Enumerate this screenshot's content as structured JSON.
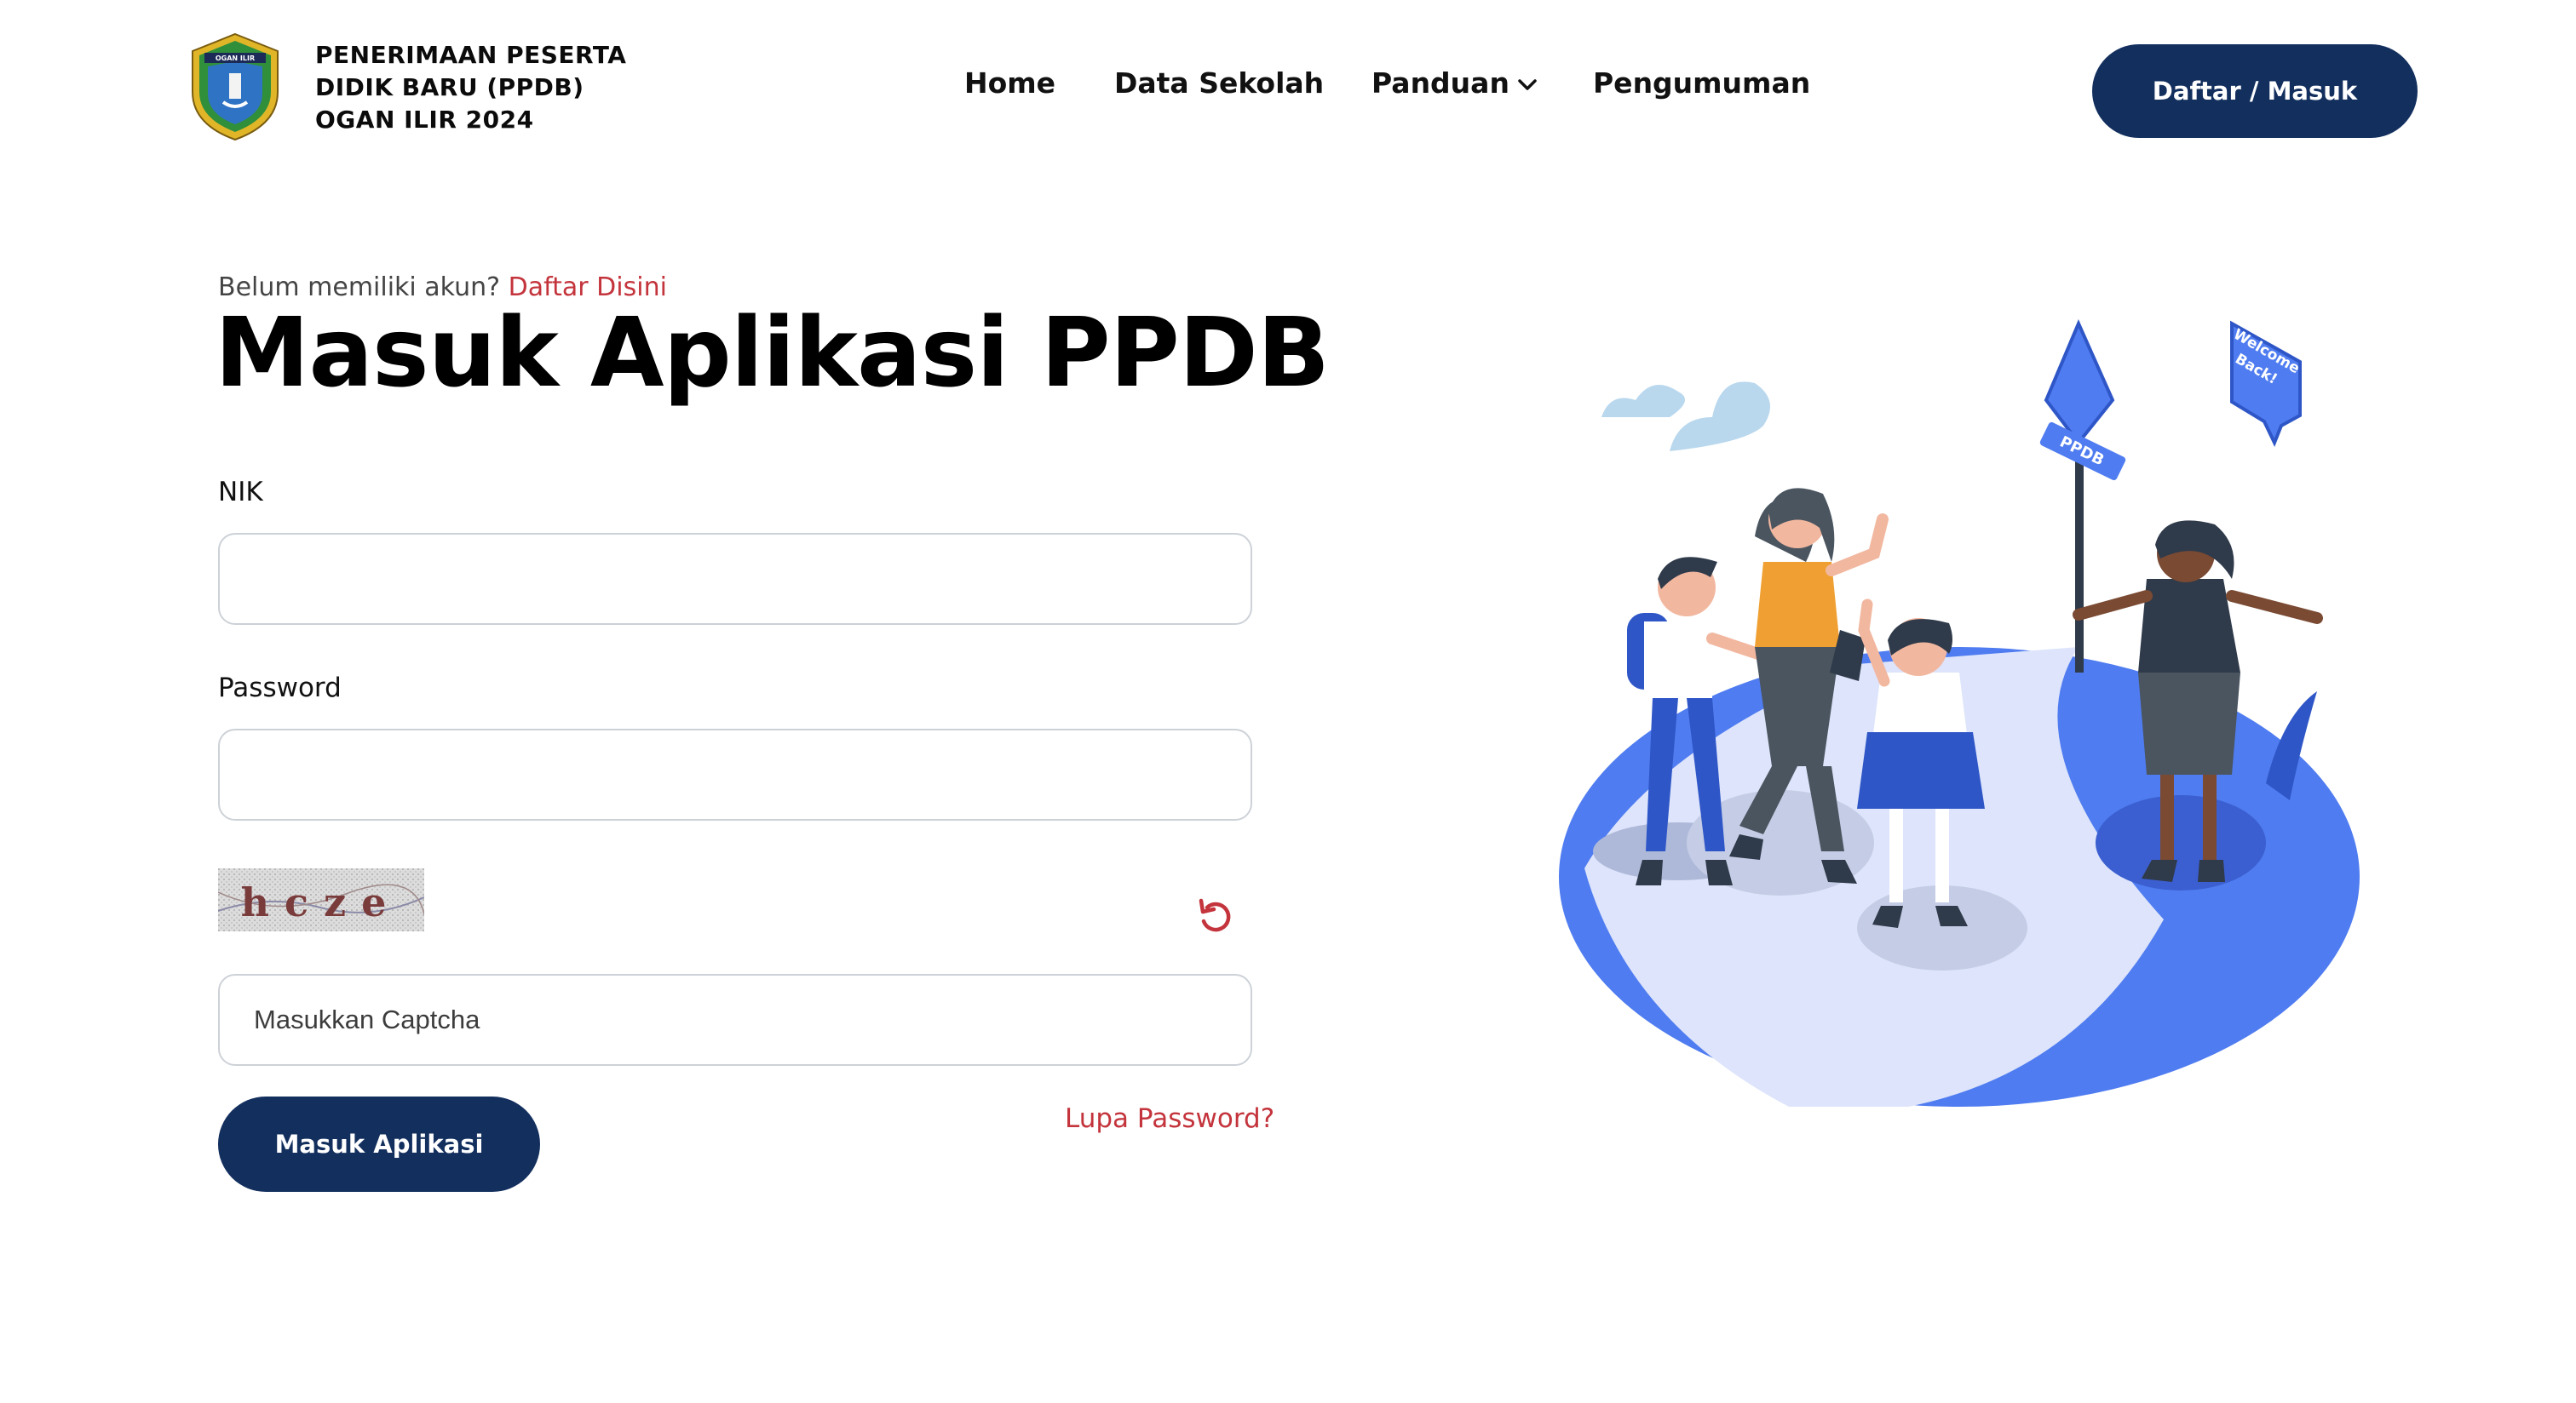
{
  "header": {
    "brand_lines": [
      "PENERIMAAN PESERTA",
      "DIDIK BARU (PPDB)",
      "OGAN ILIR 2024"
    ],
    "logo_text": "OGAN ILIR",
    "nav": [
      "Home",
      "Data Sekolah",
      "Panduan",
      "Pengumuman"
    ],
    "cta_label": "Daftar / Masuk"
  },
  "login": {
    "signup_prompt": "Belum memiliki akun?",
    "signup_link": "Daftar Disini",
    "title": "Masuk Aplikasi PPDB",
    "nik_label": "NIK",
    "nik_value": "",
    "password_label": "Password",
    "password_value": "",
    "captcha_text": "hcze",
    "captcha_placeholder": "Masukkan Captcha",
    "submit_label": "Masuk Aplikasi",
    "forgot_label": "Lupa Password?"
  },
  "illustration": {
    "sign_text": "PPDB",
    "bubble_lines": [
      "Welcome",
      "Back!"
    ]
  },
  "colors": {
    "primary": "#132f5e",
    "link": "#c4343c",
    "illustration_blue": "#4f7cf0",
    "illustration_light": "#dde4fb"
  },
  "icons": {
    "captcha_refresh": "refresh-icon",
    "panduan_dropdown": "chevron-down-icon"
  }
}
